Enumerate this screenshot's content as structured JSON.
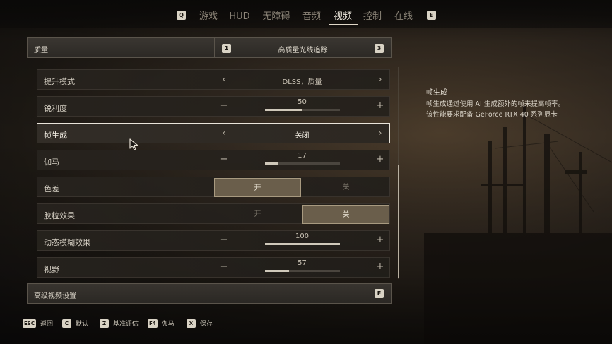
{
  "top_nav": {
    "left_key": "Q",
    "right_key": "E",
    "tabs": [
      {
        "label": "游戏",
        "active": false
      },
      {
        "label": "HUD",
        "active": false
      },
      {
        "label": "无障碍",
        "active": false
      },
      {
        "label": "音频",
        "active": false
      },
      {
        "label": "视频",
        "active": true
      },
      {
        "label": "控制",
        "active": false
      },
      {
        "label": "在线",
        "active": false
      }
    ]
  },
  "quality": {
    "label": "质量",
    "value": "高质量光线追踪",
    "prev_key": "1",
    "next_key": "3"
  },
  "settings": [
    {
      "label": "提升模式",
      "type": "choice",
      "value": "DLSS，质量"
    },
    {
      "label": "锐利度",
      "type": "slider",
      "value": "50",
      "fraction": 0.5
    },
    {
      "label": "帧生成",
      "type": "choice",
      "value": "关闭",
      "selected": true
    },
    {
      "label": "伽马",
      "type": "slider",
      "value": "17",
      "fraction": 0.17
    },
    {
      "label": "色差",
      "type": "toggle",
      "on_label": "开",
      "off_label": "关",
      "state": "on"
    },
    {
      "label": "胶粒效果",
      "type": "toggle",
      "on_label": "开",
      "off_label": "关",
      "state": "off"
    },
    {
      "label": "动态模糊效果",
      "type": "slider",
      "value": "100",
      "fraction": 1.0
    },
    {
      "label": "视野",
      "type": "slider",
      "value": "57",
      "fraction": 0.32
    }
  ],
  "controls": {
    "arrow_left": "‹",
    "arrow_right": "›",
    "minus": "−",
    "plus": "+"
  },
  "advanced": {
    "label": "高级视频设置",
    "key": "F"
  },
  "description": {
    "title": "帧生成",
    "lines": [
      "帧生成通过使用 AI 生成额外的帧来提高帧率。",
      "该性能要求配备 GeForce RTX 40 系列显卡"
    ]
  },
  "footer": {
    "hints": [
      {
        "key": "ESC",
        "label": "返回"
      },
      {
        "key": "C",
        "label": "默认"
      },
      {
        "key": "Z",
        "label": "基准评估"
      },
      {
        "key": "F4",
        "label": "伽马"
      },
      {
        "key": "X",
        "label": "保存"
      }
    ]
  },
  "colors": {
    "accent": "#e9e4da",
    "toggle_selected": "#6a5e4b"
  }
}
